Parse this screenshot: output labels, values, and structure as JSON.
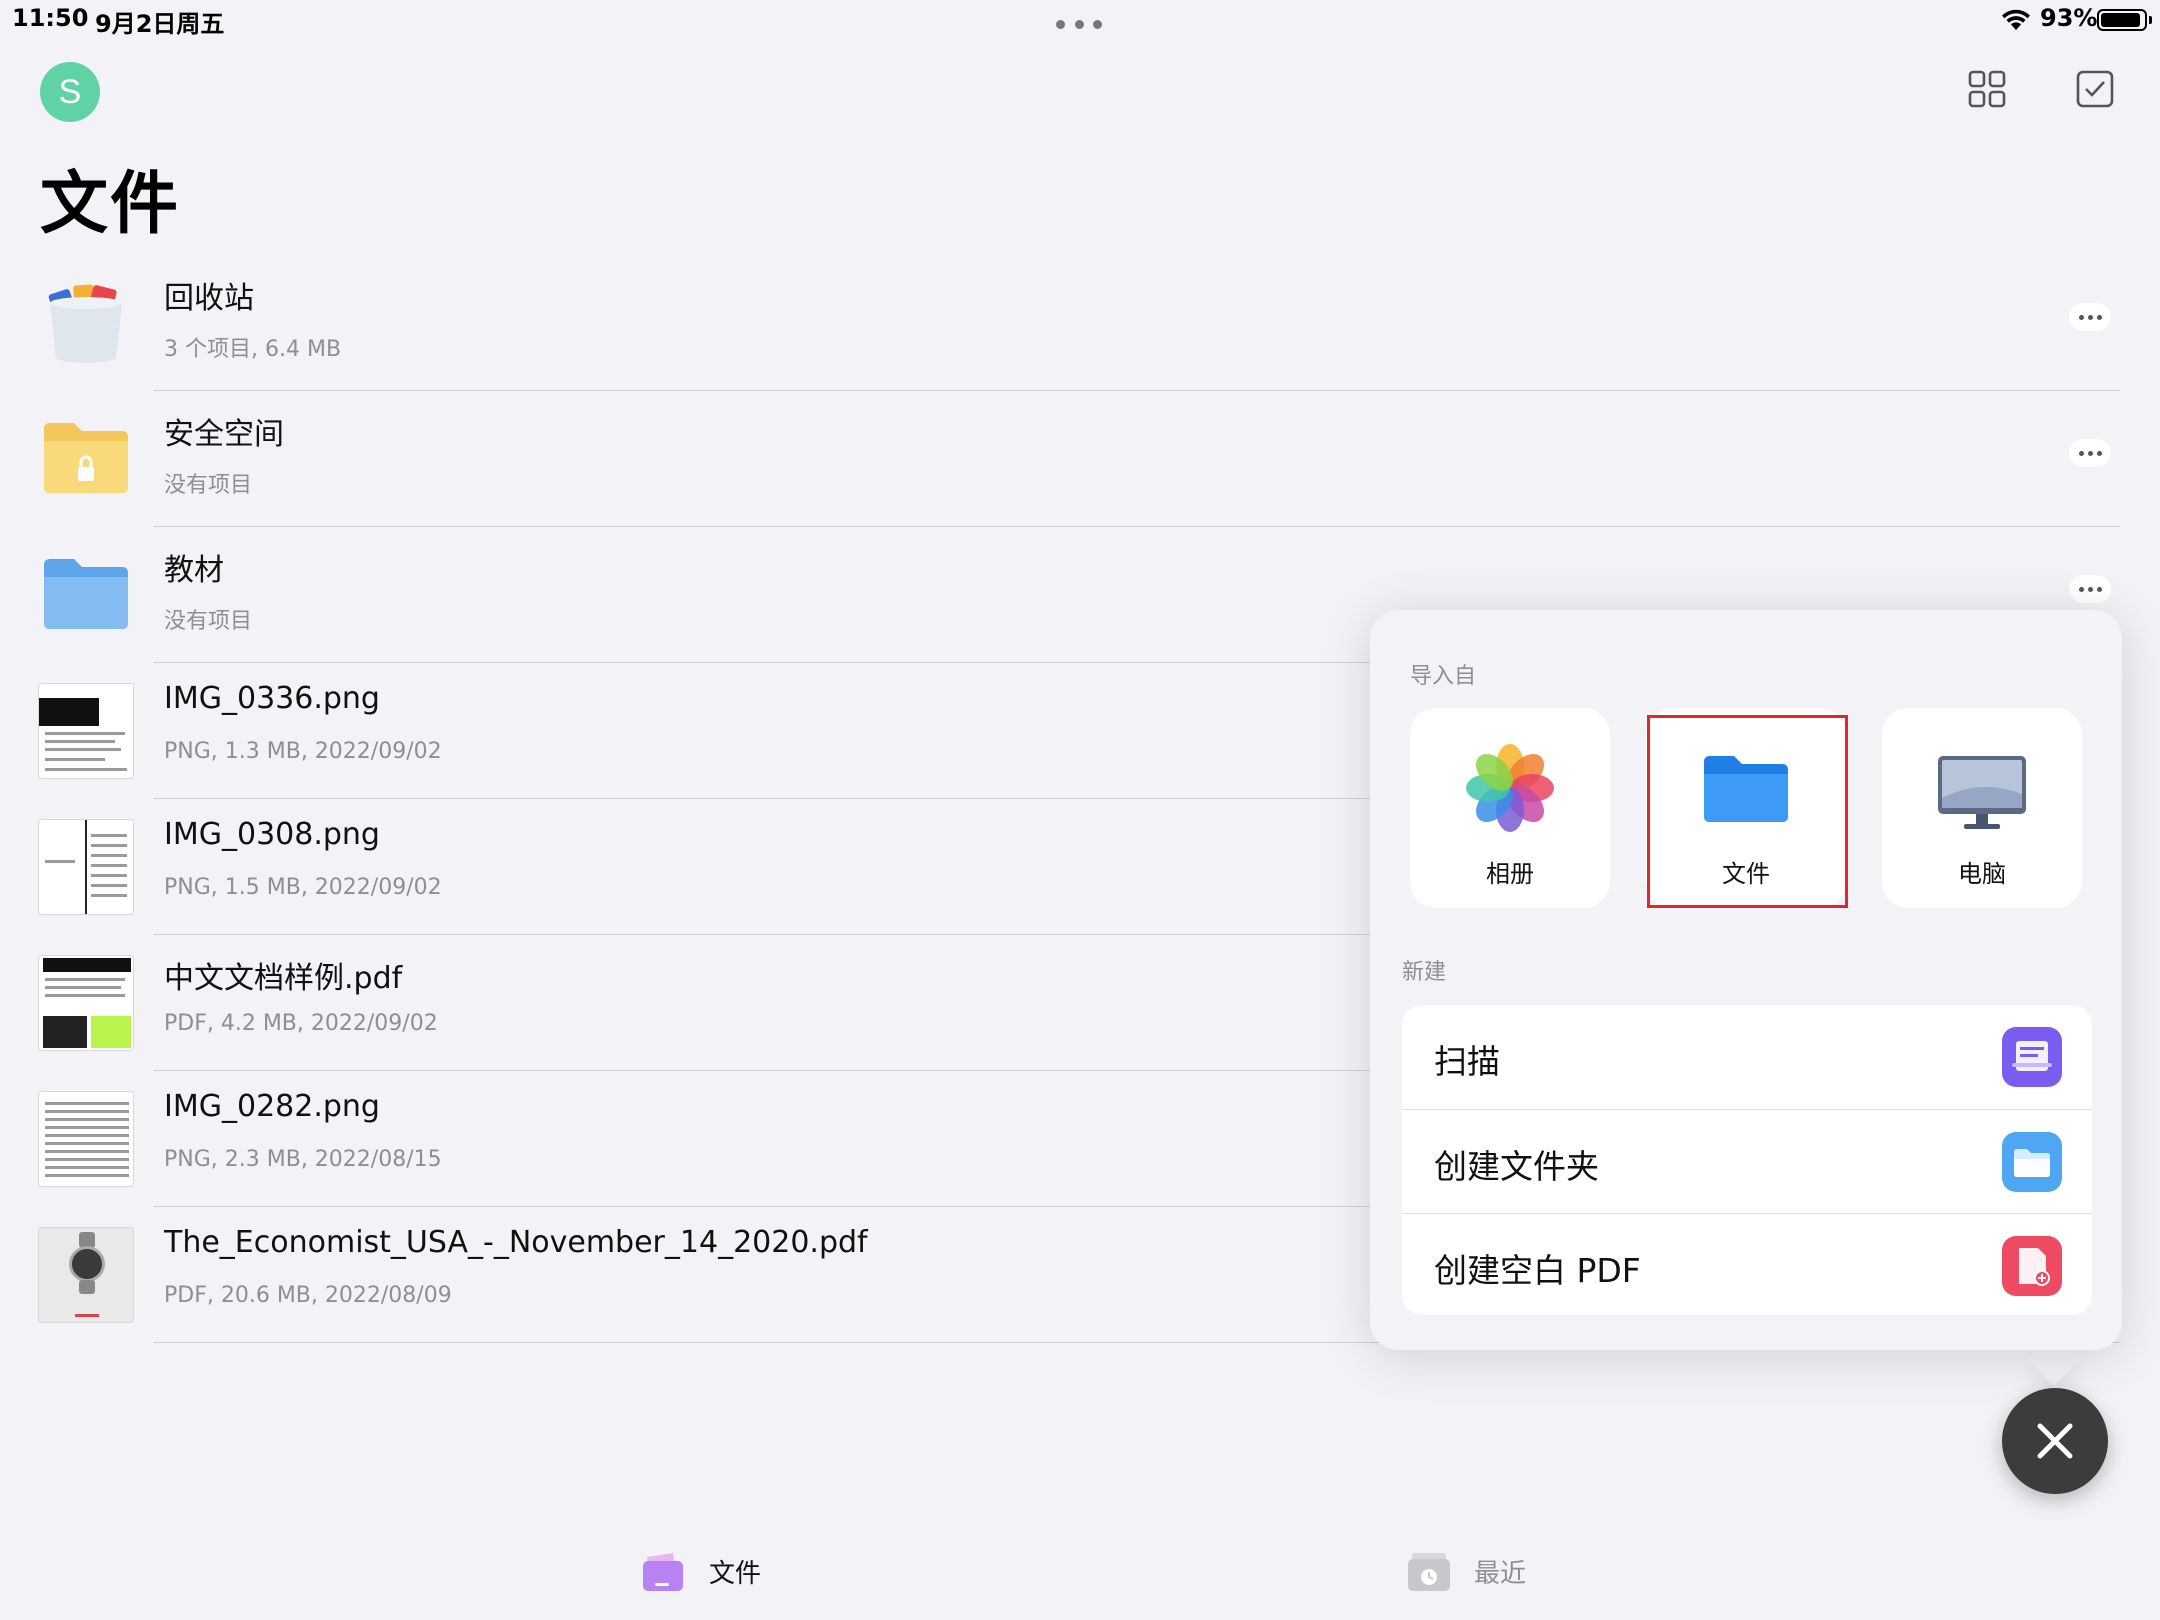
{
  "status_bar": {
    "time": "11:50",
    "date": "9月2日周五",
    "battery_percent": "93%",
    "battery_level": 0.93
  },
  "header": {
    "avatar_letter": "S",
    "title": "文件"
  },
  "files": [
    {
      "name": "回收站",
      "meta": "3 个项目, 6.4 MB",
      "icon": "trash-bin-icon"
    },
    {
      "name": "安全空间",
      "meta": "没有项目",
      "icon": "secure-folder-icon"
    },
    {
      "name": "教材",
      "meta": "没有项目",
      "icon": "folder-icon"
    },
    {
      "name": "IMG_0336.png",
      "meta": "PNG, 1.3 MB, 2022/09/02",
      "icon": "image-thumbnail"
    },
    {
      "name": "IMG_0308.png",
      "meta": "PNG, 1.5 MB, 2022/09/02",
      "icon": "image-thumbnail"
    },
    {
      "name": "中文文档样例.pdf",
      "meta": "PDF, 4.2 MB, 2022/09/02",
      "icon": "pdf-thumbnail"
    },
    {
      "name": "IMG_0282.png",
      "meta": "PNG, 2.3 MB, 2022/08/15",
      "icon": "image-thumbnail"
    },
    {
      "name": "The_Economist_USA_-_November_14_2020.pdf",
      "meta": "PDF, 20.6 MB, 2022/08/09",
      "icon": "pdf-thumbnail"
    }
  ],
  "popover": {
    "import_label": "导入自",
    "import_sources": [
      {
        "label": "相册",
        "icon": "photos-icon"
      },
      {
        "label": "文件",
        "icon": "files-folder-icon"
      },
      {
        "label": "电脑",
        "icon": "computer-icon"
      }
    ],
    "new_label": "新建",
    "new_items": [
      {
        "label": "扫描",
        "icon": "scan-icon",
        "color": "#7b5cf0"
      },
      {
        "label": "创建文件夹",
        "icon": "new-folder-icon",
        "color": "#4fa6f3"
      },
      {
        "label": "创建空白 PDF",
        "icon": "blank-pdf-icon",
        "color": "#ee4a62"
      }
    ]
  },
  "tabs": [
    {
      "label": "文件",
      "icon": "files-tab-icon",
      "active": true
    },
    {
      "label": "最近",
      "icon": "recent-tab-icon",
      "active": false
    }
  ]
}
